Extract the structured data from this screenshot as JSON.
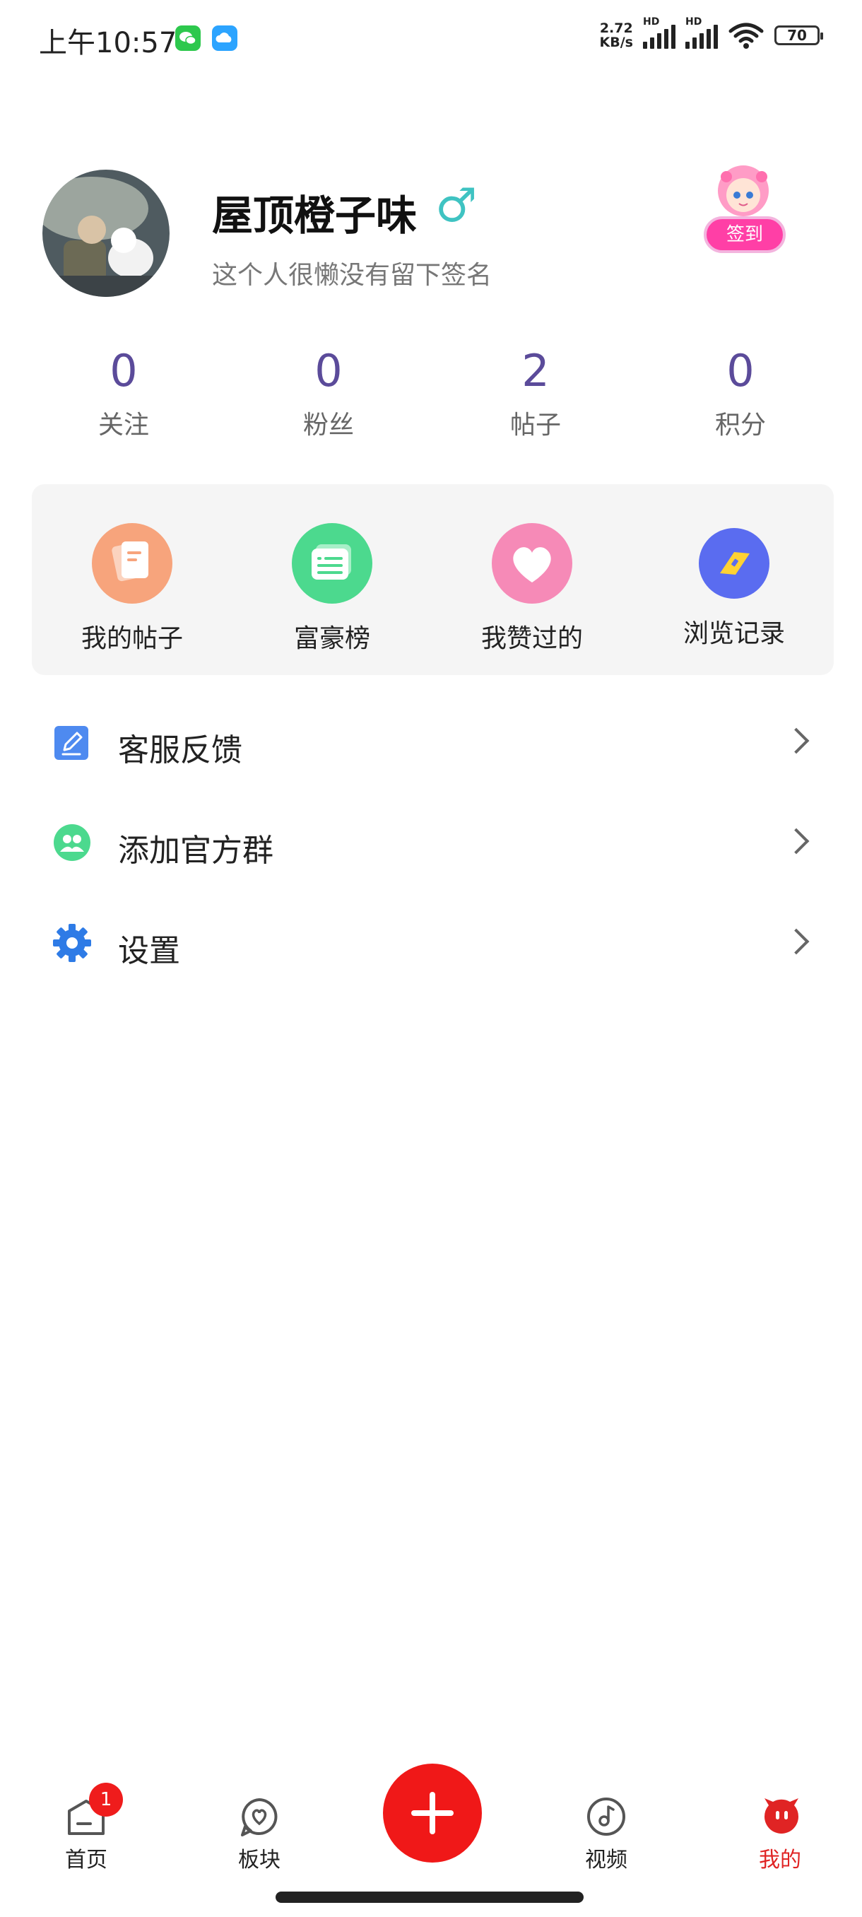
{
  "status_bar": {
    "time": "上午10:57",
    "net_speed_value": "2.72",
    "net_speed_unit": "KB/s",
    "hd_label": "HD",
    "battery": "70",
    "icons": [
      "wechat-icon",
      "cloud-icon",
      "signal-icon",
      "wifi-icon",
      "battery-icon"
    ]
  },
  "profile": {
    "username": "屋顶橙子味",
    "gender_symbol": "♂",
    "signature": "这个人很懒没有留下签名",
    "checkin_label": "签到"
  },
  "stats": [
    {
      "value": "0",
      "label": "关注"
    },
    {
      "value": "0",
      "label": "粉丝"
    },
    {
      "value": "2",
      "label": "帖子"
    },
    {
      "value": "0",
      "label": "积分"
    }
  ],
  "quick_actions": [
    {
      "label": "我的帖子",
      "icon": "document-icon",
      "color": "#f7a47c"
    },
    {
      "label": "富豪榜",
      "icon": "list-card-icon",
      "color": "#4cd98e"
    },
    {
      "label": "我赞过的",
      "icon": "heart-icon",
      "color": "#f68ab7"
    },
    {
      "label": "浏览记录",
      "icon": "ticket-icon",
      "color": "#5a6cf0"
    }
  ],
  "menu": [
    {
      "label": "客服反馈",
      "icon": "edit-icon",
      "color": "#4e8af0"
    },
    {
      "label": "添加官方群",
      "icon": "group-icon",
      "color": "#4cd98e"
    },
    {
      "label": "设置",
      "icon": "gear-icon",
      "color": "#2e7be6"
    }
  ],
  "nav": {
    "tabs": [
      {
        "label": "首页",
        "icon": "home-icon"
      },
      {
        "label": "板块",
        "icon": "forum-icon"
      },
      {
        "label": "视频",
        "icon": "music-disc-icon"
      },
      {
        "label": "我的",
        "icon": "profile-face-icon"
      }
    ],
    "home_badge": "1",
    "accent_color": "#e02424"
  }
}
